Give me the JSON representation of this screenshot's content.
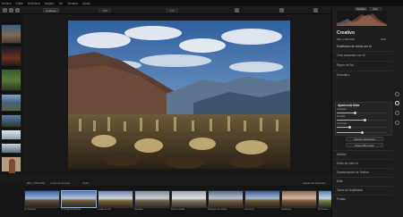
{
  "menu": [
    "Archivo",
    "Editar",
    "Biblioteca",
    "Imagen",
    "Ver",
    "Ventana",
    "Ayuda"
  ],
  "toolbar": {
    "view_button": "Catálogo",
    "zoom_left": "100",
    "zoom_mid": "1:1",
    "histogram_tab_a": "Ajustes",
    "histogram_tab_b": "Histo"
  },
  "right_panel": {
    "preset_title": "Creativo",
    "file_name": "IMG_3758.DNG",
    "file_meta": "3000",
    "layer_label": "Sustitución de cielos con AI",
    "items": [
      "Cielo avanzado con AI",
      "Rayos de Sol",
      "Dramático"
    ],
    "active_section": "Apariencia Mate",
    "sliders": [
      {
        "label": "Cantidad",
        "value": 0.35
      },
      {
        "label": "Fundido",
        "value": 0.55
      },
      {
        "label": "Contraste",
        "value": 0.25
      },
      {
        "label": "Matiz",
        "value": 0.5
      }
    ],
    "apply_button": "Ajustes avanzados",
    "reset_button": "Nuevo filtro mate",
    "sections_after": [
      "Mística",
      "Estilo de color AI",
      "Superposición de Textura",
      "Brillo",
      "Tonos de Duplicidad",
      "Pelada"
    ]
  },
  "bottom": {
    "film_header_left": "IMG_3758.DNG",
    "film_header_sort": "Looks de Luminar",
    "film_header_filter": "Todos",
    "film_header_right": "Apariencia Favoritos"
  },
  "presets": [
    "Lo Original",
    "AI Image Enhancer",
    "Looks de sol",
    "Nublado",
    "Día de niebla",
    "Retoque de retrato",
    "Aventura",
    "Atardecer",
    "Primavera"
  ]
}
